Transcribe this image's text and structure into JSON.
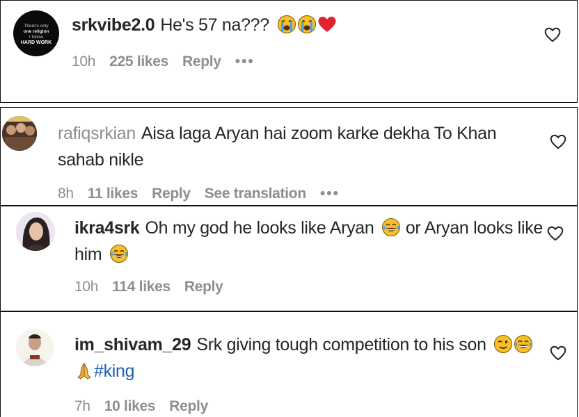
{
  "comments": [
    {
      "username": "srkvibe2.0",
      "text": "He's 57 na???",
      "emoji": [
        "loudly-crying",
        "loudly-crying",
        "red-heart"
      ],
      "time": "10h",
      "likes": "225 likes",
      "reply": "Reply",
      "more": "•••",
      "avatar_text": [
        "There's only",
        "one religion",
        "I follow",
        "HARD WORK"
      ]
    },
    {
      "username": "rafiqsrkian",
      "text_line1": "Aisa laga Aryan hai zoom karke dekha To Khan",
      "text_line2": "sahab nikle",
      "time": "8h",
      "likes": "11 likes",
      "reply": "Reply",
      "see_translation": "See translation",
      "more": "•••"
    },
    {
      "username": "ikra4srk",
      "text_a": "Oh my god he looks like Aryan",
      "text_b": "or Aryan looks like",
      "text_line2": "him",
      "emoji": [
        "tears-of-joy",
        "tears-of-joy"
      ],
      "time": "10h",
      "likes": "114 likes",
      "reply": "Reply"
    },
    {
      "username": "im_shivam_29",
      "text": "Srk giving tough competition to his son",
      "hashtag": "#king",
      "emoji": [
        "wink",
        "tears-of-joy",
        "folded-hands"
      ],
      "time": "7h",
      "likes": "10 likes",
      "reply": "Reply"
    }
  ],
  "colors": {
    "text": "#262626",
    "muted": "#8e8e8e",
    "hashtag": "#1a5fb4",
    "border": "#111111",
    "heart_red": "#e0242f",
    "emoji_yellow": "#f7c02a",
    "tear_blue": "#4aa3e8"
  }
}
